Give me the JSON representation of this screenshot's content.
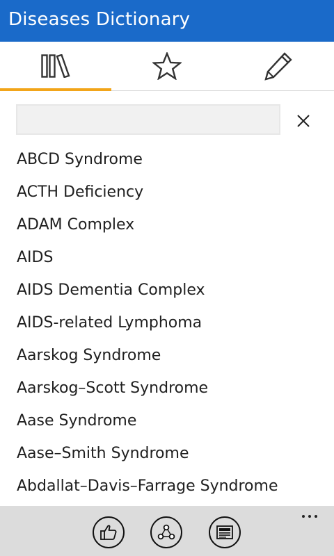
{
  "app": {
    "title": "Diseases Dictionary",
    "accent_color": "#1a6ac9",
    "tab_indicator_color": "#f2a51a"
  },
  "tabs": [
    {
      "icon": "library-icon",
      "selected": true
    },
    {
      "icon": "star-icon",
      "selected": false
    },
    {
      "icon": "pencil-icon",
      "selected": false
    }
  ],
  "search": {
    "value": "",
    "placeholder": "",
    "clear_icon": "close-icon"
  },
  "list": {
    "items": [
      {
        "label": "ABCD Syndrome"
      },
      {
        "label": "ACTH Deficiency"
      },
      {
        "label": "ADAM Complex"
      },
      {
        "label": "AIDS"
      },
      {
        "label": "AIDS Dementia Complex"
      },
      {
        "label": "AIDS-related Lymphoma"
      },
      {
        "label": "Aarskog Syndrome"
      },
      {
        "label": "Aarskog–Scott Syndrome"
      },
      {
        "label": "Aase Syndrome"
      },
      {
        "label": "Aase–Smith Syndrome"
      },
      {
        "label": "Abdallat–Davis–Farrage Syndrome"
      }
    ]
  },
  "appbar": {
    "buttons": [
      {
        "icon": "thumbs-up-icon"
      },
      {
        "icon": "share-icon"
      },
      {
        "icon": "news-icon"
      }
    ],
    "more_icon": "more-icon"
  }
}
